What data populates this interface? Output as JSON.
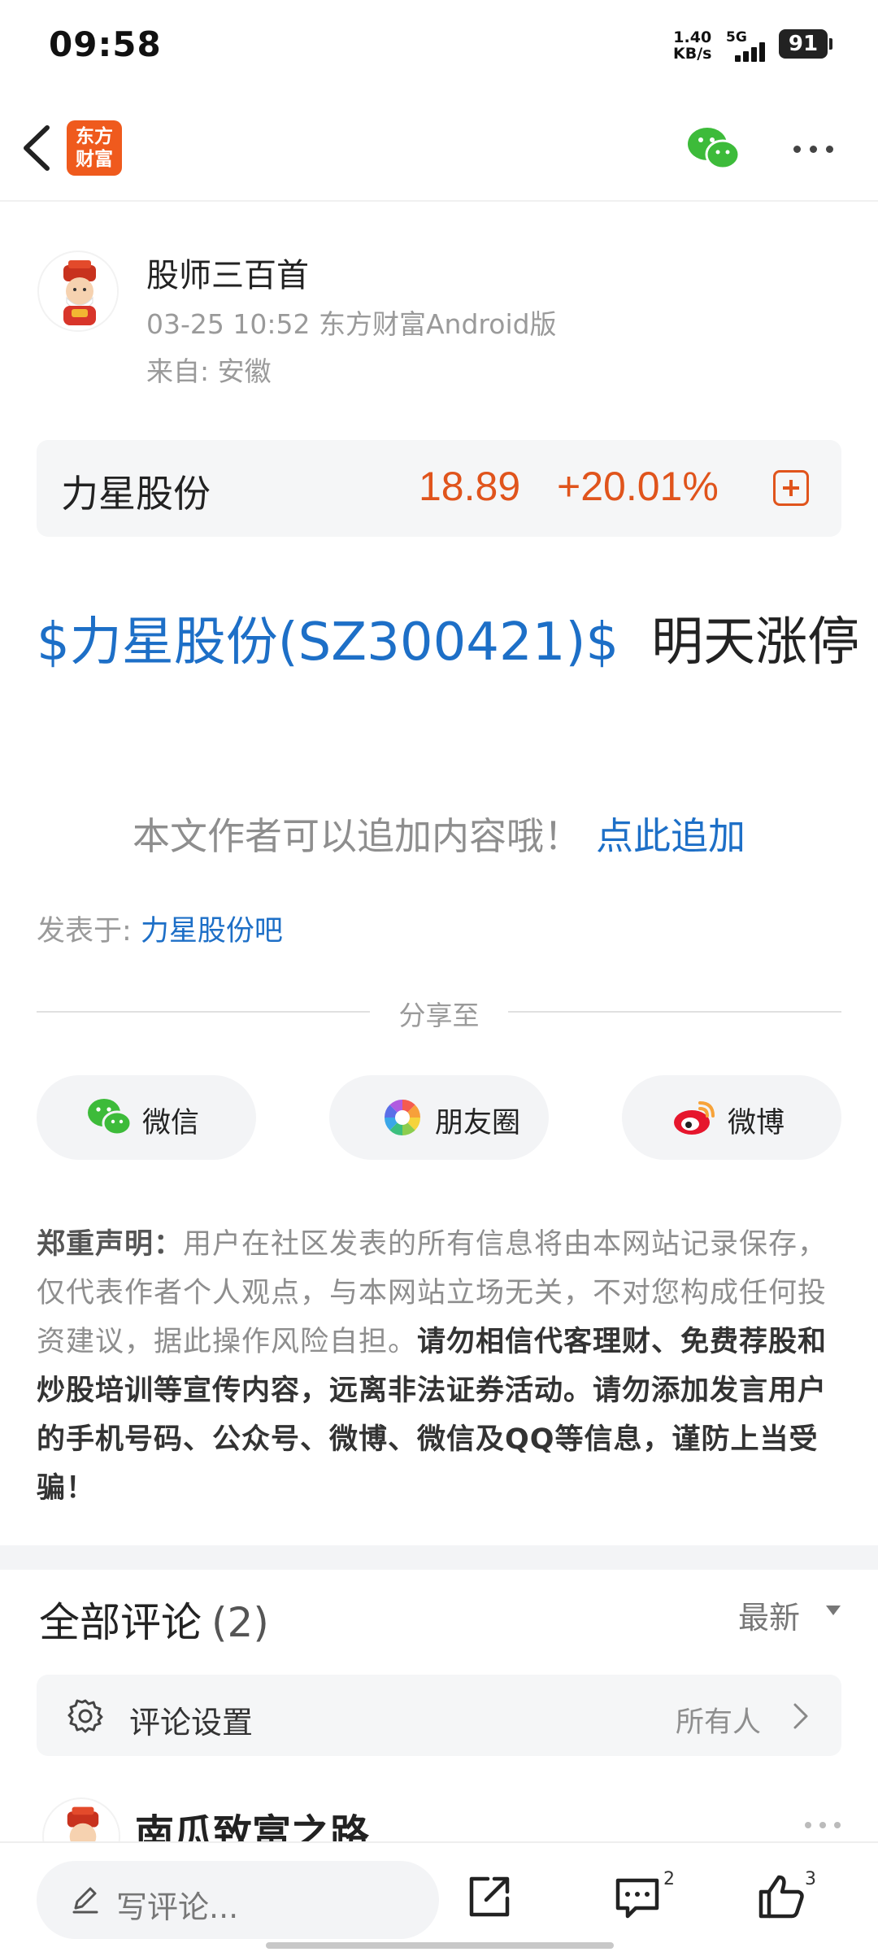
{
  "status_bar": {
    "time": "09:58",
    "net_speed_value": "1.40",
    "net_speed_unit": "KB/s",
    "network_type": "5G",
    "battery": "91"
  },
  "nav": {
    "logo_line1": "东方",
    "logo_line2": "财富",
    "icons": [
      "back-icon",
      "wechat-icon",
      "more-icon"
    ]
  },
  "author": {
    "name": "股师三百首",
    "meta": "03-25 10:52 东方财富Android版",
    "location": "来自: 安徽"
  },
  "stock_card": {
    "name": "力星股份",
    "price": "18.89",
    "change": "+20.01%",
    "accent_color": "#e0541c"
  },
  "post": {
    "stock_link": "$力星股份(SZ300421)$",
    "text": "明天涨停",
    "append_text": "本文作者可以追加内容哦！",
    "append_link": "点此追加",
    "posted_label": "发表于: ",
    "posted_bar": "力星股份吧",
    "link_color": "#1d6fc7"
  },
  "share": {
    "title": "分享至",
    "buttons": [
      {
        "label": "微信",
        "icon": "wechat-icon"
      },
      {
        "label": "朋友圈",
        "icon": "moments-icon"
      },
      {
        "label": "微博",
        "icon": "weibo-icon"
      }
    ]
  },
  "disclaimer": {
    "title": "郑重声明：",
    "normal": "用户在社区发表的所有信息将由本网站记录保存，仅代表作者个人观点，与本网站立场无关，不对您构成任何投资建议，据此操作风险自担。",
    "bold": "请勿相信代客理财、免费荐股和炒股培训等宣传内容，远离非法证券活动。请勿添加发言用户的手机号码、公众号、微博、微信及QQ等信息，谨防上当受骗！"
  },
  "comments": {
    "title": "全部评论",
    "count": "(2)",
    "sort": "最新",
    "settings_label": "评论设置",
    "settings_value": "所有人",
    "first_user": "南瓜致富之路"
  },
  "bottom_bar": {
    "placeholder": "写评论...",
    "comment_count": "2",
    "like_count": "3"
  }
}
